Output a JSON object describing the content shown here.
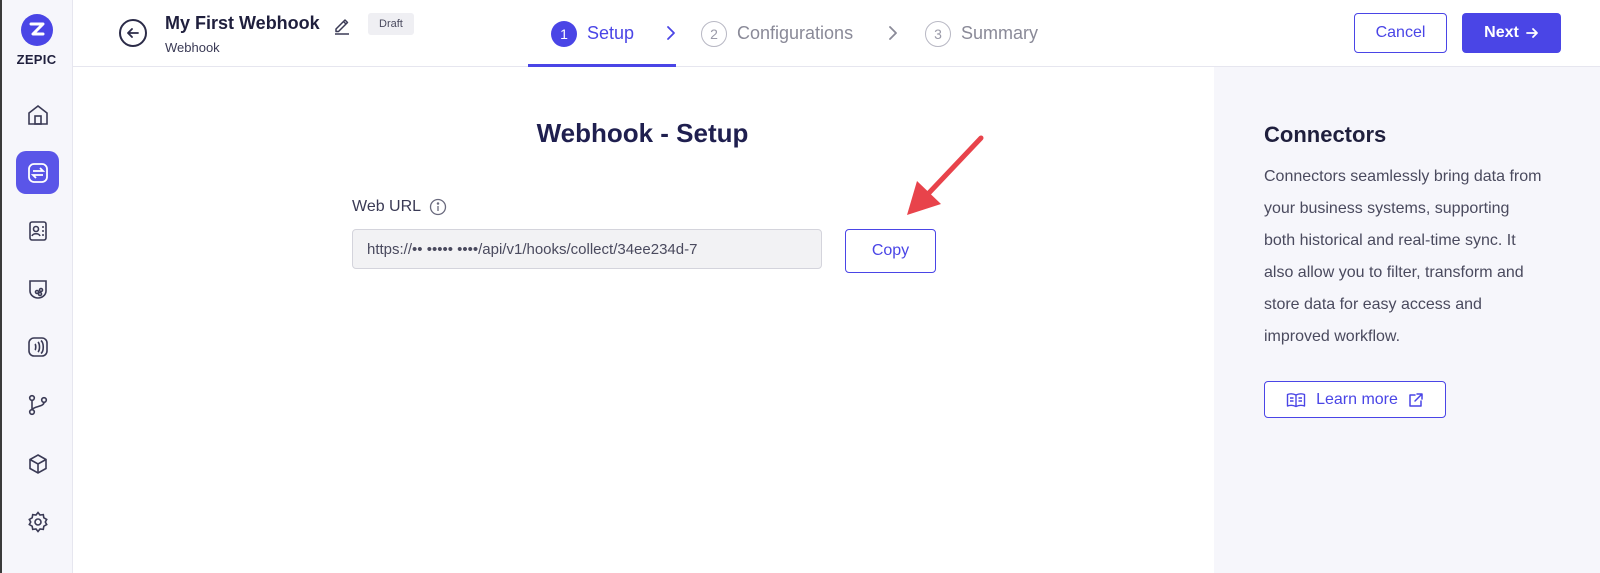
{
  "brand": {
    "name": "ZEPIC"
  },
  "sidebar": {
    "items": [
      {
        "icon": "home-icon"
      },
      {
        "icon": "integrations-icon",
        "active": true
      },
      {
        "icon": "contacts-icon"
      },
      {
        "icon": "segments-icon"
      },
      {
        "icon": "broadcast-icon"
      },
      {
        "icon": "flows-icon"
      },
      {
        "icon": "package-icon"
      },
      {
        "icon": "settings-icon"
      }
    ]
  },
  "header": {
    "title": "My First Webhook",
    "subtitle": "Webhook",
    "badge": "Draft",
    "steps": [
      {
        "num": "1",
        "label": "Setup",
        "active": true
      },
      {
        "num": "2",
        "label": "Configurations",
        "active": false
      },
      {
        "num": "3",
        "label": "Summary",
        "active": false
      }
    ],
    "cancel_label": "Cancel",
    "next_label": "Next"
  },
  "main": {
    "title": "Webhook - Setup",
    "field_label": "Web URL",
    "url_value": "https://•• ••••• ••••/api/v1/hooks/collect/34ee234d-7",
    "copy_label": "Copy"
  },
  "side_panel": {
    "title": "Connectors",
    "body": "Connectors seamlessly bring data from your business systems, supporting both historical and real-time sync. It also allow you to filter, transform and store data for easy access and improved workflow.",
    "learn_more_label": "Learn more"
  },
  "colors": {
    "accent": "#4a45e6",
    "annotation_arrow": "#e8434b"
  }
}
